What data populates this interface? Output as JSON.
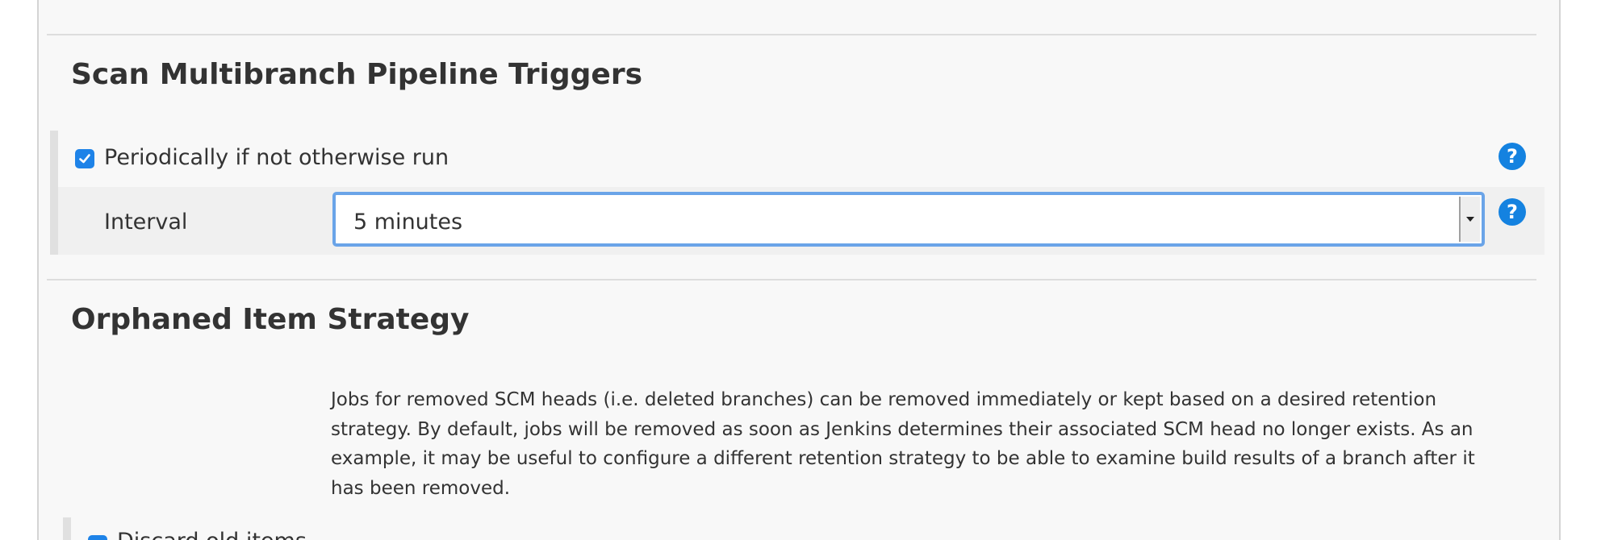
{
  "triggers_section": {
    "title": "Scan Multibranch Pipeline Triggers",
    "periodic_checkbox": {
      "label": "Periodically if not otherwise run",
      "checked": true
    },
    "interval": {
      "label": "Interval",
      "selected_value": "5 minutes"
    },
    "help_icon_glyph": "?"
  },
  "orphaned_section": {
    "title": "Orphaned Item Strategy",
    "description": "Jobs for removed SCM heads (i.e. deleted branches) can be removed immediately or kept based on a desired retention strategy. By default, jobs will be removed as soon as Jenkins determines their associated SCM head no longer exists. As an example, it may be useful to configure a different retention strategy to be able to examine build results of a branch after it has been removed.",
    "discard_checkbox": {
      "label": "Discard old items",
      "checked": true
    }
  },
  "icons": {
    "checkbox": "check-icon",
    "help": "help-question-icon",
    "dropdown": "caret-down-icon"
  },
  "colors": {
    "accent": "#1e83e8",
    "help_icon": "#1482e0",
    "select_focus_border": "#6aa4e8",
    "panel_background": "#f8f8f8"
  }
}
